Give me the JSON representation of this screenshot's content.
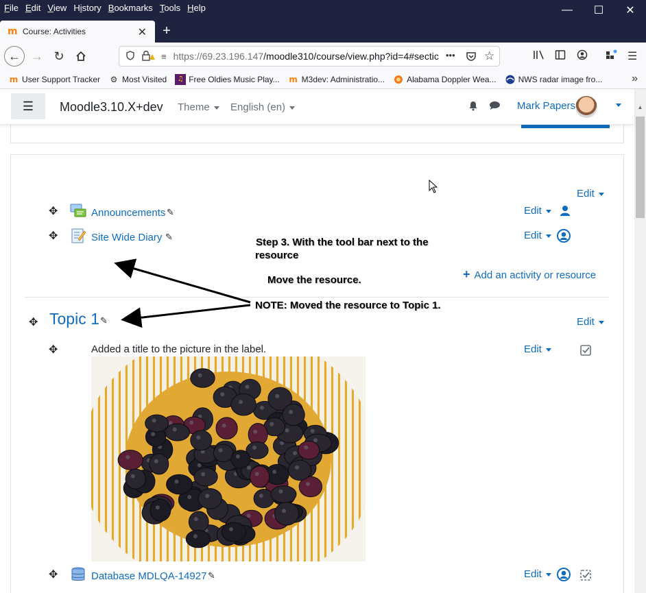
{
  "browser": {
    "menu": [
      "File",
      "Edit",
      "View",
      "History",
      "Bookmarks",
      "Tools",
      "Help"
    ],
    "menu_accel": [
      "F",
      "E",
      "V",
      "i",
      "B",
      "T",
      "H"
    ],
    "tab_title": "Course: Activities",
    "url_host": "https://69.23.196.147",
    "url_path": "/moodle310/course/view.php?id=4#sectic",
    "url_more": "•••",
    "bookmarks": [
      {
        "label": "User Support Tracker",
        "icon": "moodle-icon"
      },
      {
        "label": "Most Visited",
        "icon": "gear-icon"
      },
      {
        "label": "Free Oldies Music Play...",
        "icon": "radio-icon"
      },
      {
        "label": "M3dev: Administratio...",
        "icon": "moodle-icon"
      },
      {
        "label": "Alabama Doppler Wea...",
        "icon": "weather-icon"
      },
      {
        "label": "NWS radar image fro...",
        "icon": "nws-icon"
      }
    ],
    "overflow": "»"
  },
  "moodle": {
    "site_name": "Moodle3.10.X+dev",
    "theme_label": "Theme",
    "language_label": "English (en)",
    "user_name": "Mark Papers",
    "accent": "#0f6cbf"
  },
  "course": {
    "section0": {
      "edit_label": "Edit",
      "activities": [
        {
          "name": "Announcements",
          "edit_label": "Edit",
          "icon": "forum-icon",
          "status_icon": "user-icon"
        },
        {
          "name": "Site Wide Diary",
          "edit_label": "Edit",
          "icon": "diary-icon",
          "status_icon": "user-circle-icon"
        }
      ],
      "add_label": "Add an activity or resource"
    },
    "topic1": {
      "title": "Topic 1",
      "edit_label": "Edit",
      "label_item": {
        "text": "Added a title to the picture in the label.",
        "edit_label": "Edit"
      },
      "database": {
        "name": "Database MDLQA-14927",
        "edit_label": "Edit"
      }
    }
  },
  "annotations": {
    "step3_line1": "Step 3. With the tool bar next to the",
    "step3_line2": "resource",
    "move": "Move the resource.",
    "note": "NOTE: Moved the resource to Topic 1."
  }
}
